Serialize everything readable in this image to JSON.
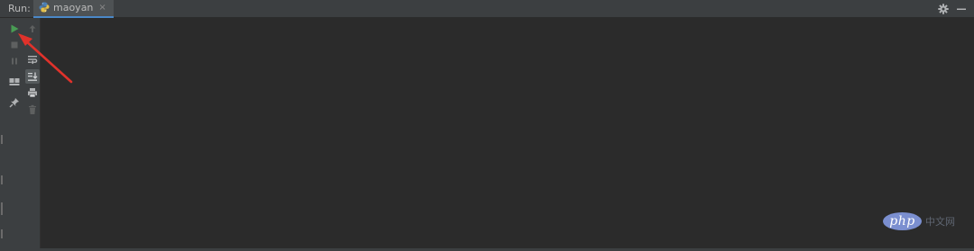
{
  "header": {
    "run_label": "Run:",
    "tab": {
      "label": "maoyan",
      "icon": "python-icon"
    }
  },
  "toolbar": {
    "primary": [
      {
        "name": "rerun-button",
        "icon": "play-icon",
        "color": "#499c54"
      },
      {
        "name": "stop-button",
        "icon": "stop-icon"
      },
      {
        "name": "pause-button",
        "icon": "pause-icon"
      },
      {
        "name": "restore-layout-button",
        "icon": "layout-icon"
      },
      {
        "name": "pin-tab-button",
        "icon": "pin-icon"
      }
    ],
    "secondary": [
      {
        "name": "up-button",
        "icon": "arrow-up-icon"
      },
      {
        "name": "soft-wrap-button",
        "icon": "soft-wrap-icon"
      },
      {
        "name": "scroll-to-end-button",
        "icon": "scroll-to-end-icon",
        "active": true
      },
      {
        "name": "print-button",
        "icon": "print-icon"
      },
      {
        "name": "clear-all-button",
        "icon": "trash-icon"
      }
    ]
  },
  "header_actions": [
    {
      "name": "settings-button",
      "icon": "gear-icon"
    },
    {
      "name": "hide-button",
      "icon": "minimize-icon"
    }
  ],
  "annotation": {
    "color": "#e0322b"
  },
  "watermark": {
    "badge": "php",
    "text": "中文网"
  }
}
